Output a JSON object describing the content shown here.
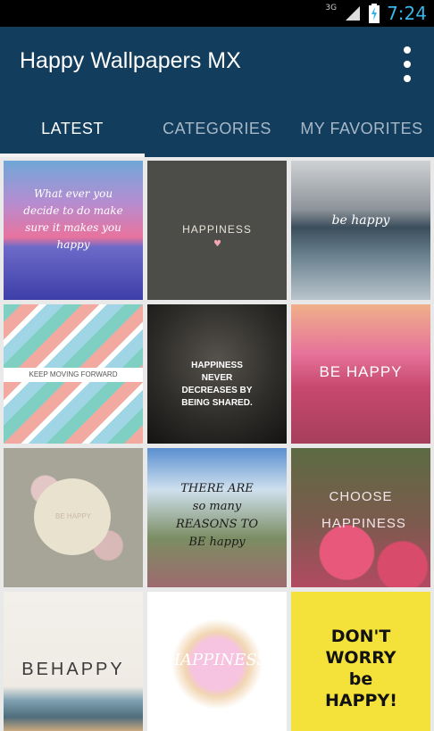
{
  "status": {
    "network": "3G",
    "time": "7:24"
  },
  "app": {
    "title": "Happy Wallpapers MX"
  },
  "tabs": [
    {
      "label": "LATEST",
      "active": true
    },
    {
      "label": "CATEGORIES",
      "active": false
    },
    {
      "label": "MY FAVORITES",
      "active": false
    }
  ],
  "tiles": [
    {
      "text": "What ever you decide to do make sure it makes you happy"
    },
    {
      "text": "HAPPINESS"
    },
    {
      "text": "be happy"
    },
    {
      "text": "KEEP MOVING FORWARD"
    },
    {
      "text": "HAPPINESS NEVER DECREASES BY BEING SHARED."
    },
    {
      "text": "BE HAPPY"
    },
    {
      "text": "BE HAPPY"
    },
    {
      "text": "THERE ARE so many REASONS TO BE happy"
    },
    {
      "text": "CHOOSE HAPPINESS"
    },
    {
      "text": "BEHAPPY"
    },
    {
      "text": "HAPPINESS"
    },
    {
      "text": "DON'T WORRY be HAPPY!"
    }
  ],
  "colors": {
    "appbar": "#123d5c",
    "tab_inactive": "#a7b8c8",
    "status_time": "#39b5e9"
  }
}
